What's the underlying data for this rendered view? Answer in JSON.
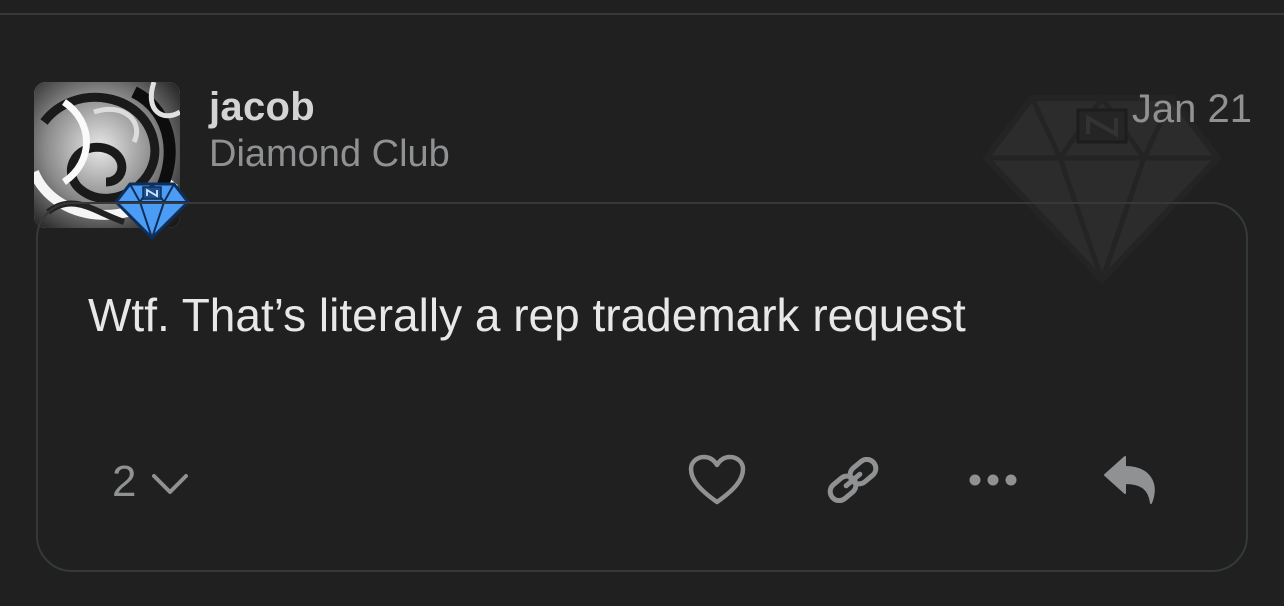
{
  "post": {
    "username": "jacob",
    "user_title": "Diamond Club",
    "date": "Jan 21",
    "body": "Wtf. That’s literally a rep trademark request",
    "reply_count": "2"
  },
  "icons": {
    "avatar": "avatar-swirl-image",
    "flair": "diamond-flair-icon",
    "watermark": "diamond-watermark-icon",
    "replies_toggle": "chevron-down-icon",
    "like": "heart-icon",
    "link": "link-icon",
    "more": "ellipsis-icon",
    "reply": "reply-icon"
  },
  "colors": {
    "background": "#202020",
    "card_border": "#34393a",
    "body_text": "#e8e8e8",
    "muted_text": "#8f9193",
    "username_text": "#d4d4d4",
    "flair_blue": "#4a9cf5"
  }
}
